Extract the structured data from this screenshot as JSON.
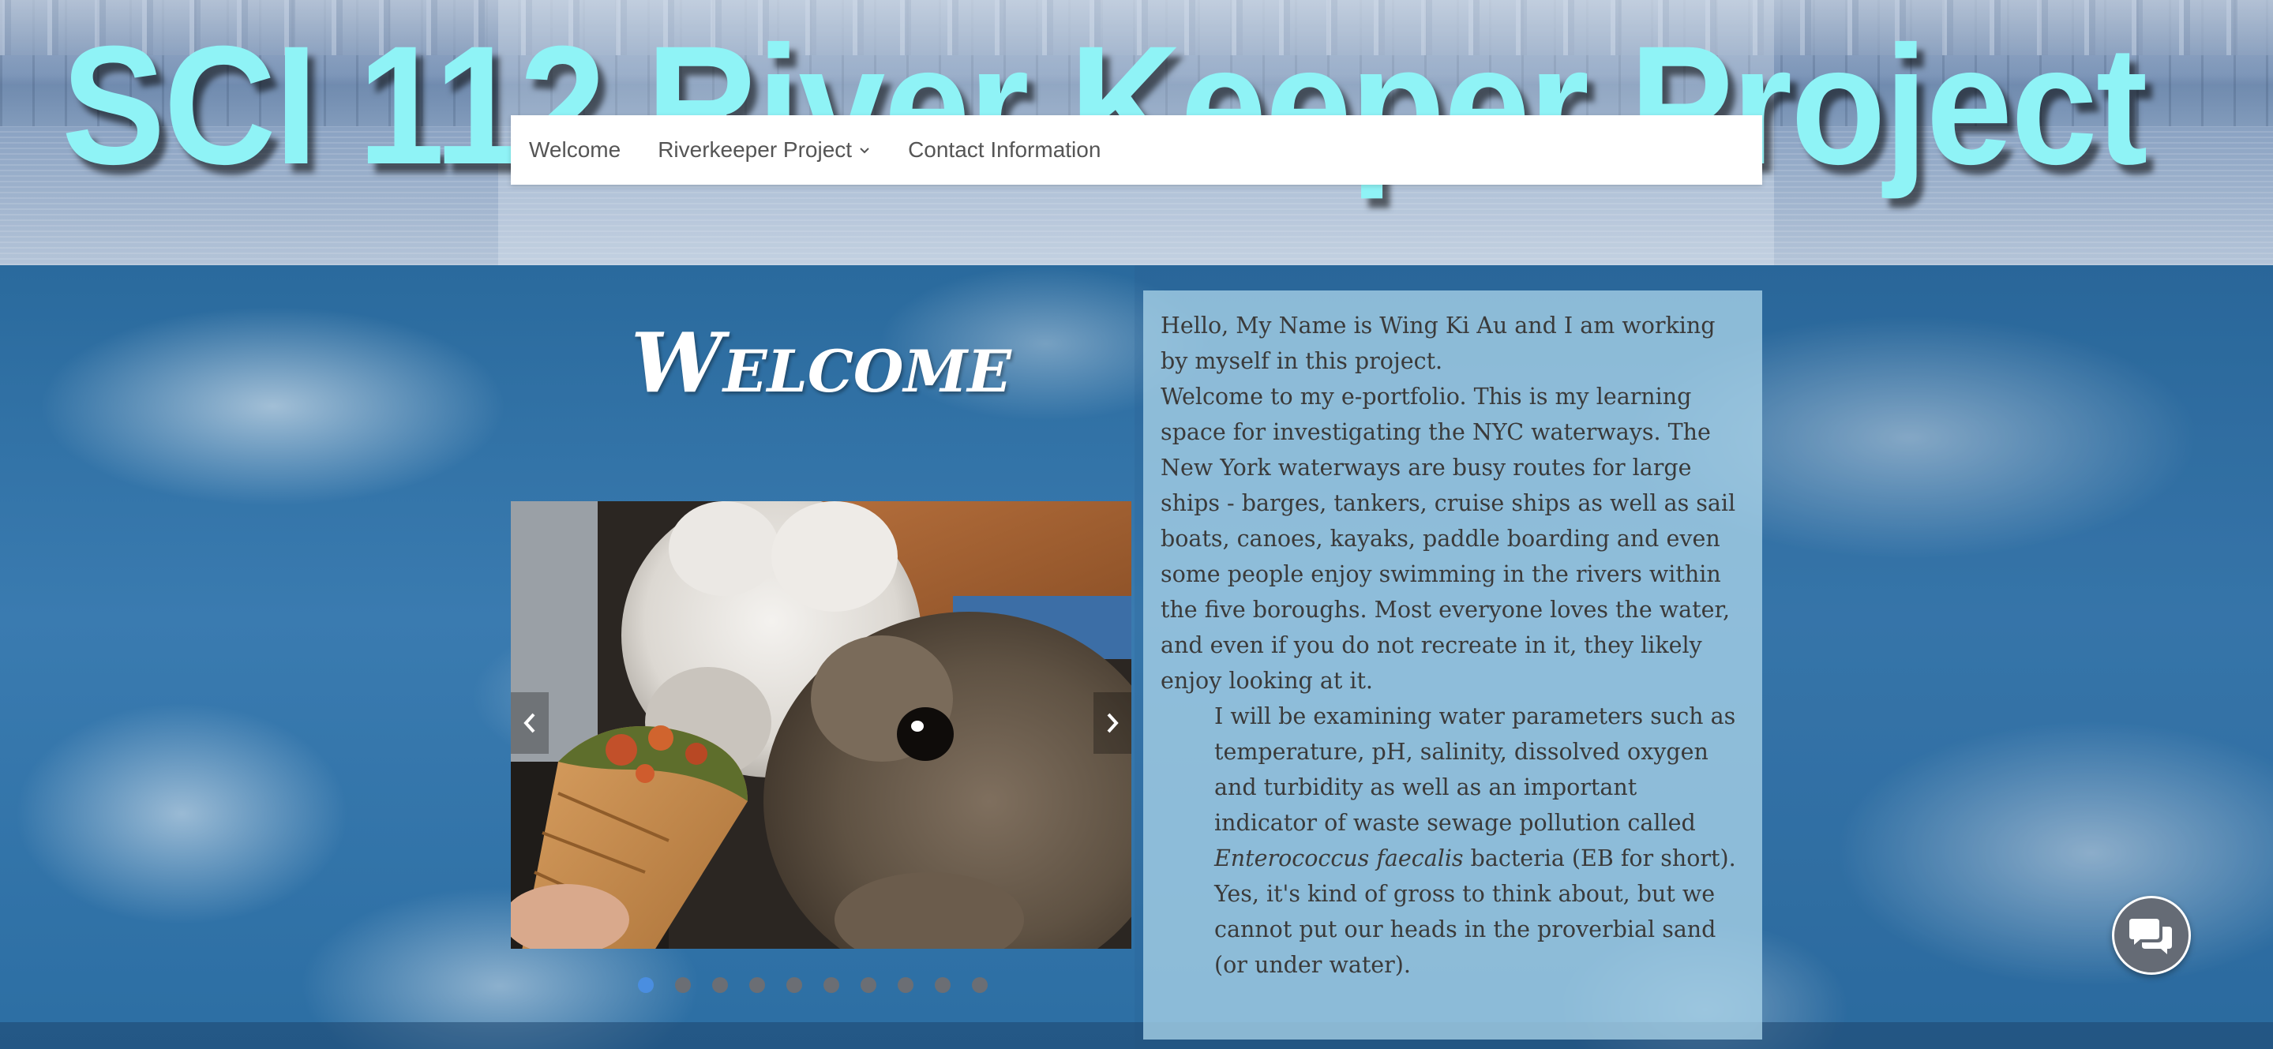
{
  "header": {
    "site_title": "SCI 112 River Keeper Project"
  },
  "nav": {
    "items": [
      {
        "label": "Welcome"
      },
      {
        "label": "Riverkeeper Project",
        "icon": "chevron-down-icon"
      },
      {
        "label": "Contact Information"
      }
    ]
  },
  "main": {
    "welcome_heading": "Welcome",
    "slideshow": {
      "slide_count": 10,
      "active_index": 0,
      "prev_icon": "chevron-left-icon",
      "next_icon": "chevron-right-icon"
    },
    "intro": {
      "p1": " Hello, My Name is Wing Ki Au and I am working by myself in this project.",
      "p2": "Welcome  to my e-portfolio. This is my learning space for investigating the NYC  waterways. The New York waterways are busy routes for large ships -  barges, tankers, cruise ships as well as sail boats, canoes, kayaks, paddle boarding and even some people enjoy swimming in the rivers within  the five boroughs. Most everyone loves the water, and even if you do  not recreate in it, they likely enjoy looking at it.",
      "p3_before": "I will be examining water parameters such  as temperature, pH, salinity, dissolved oxygen and turbidity as well as  an important indicator of waste sewage pollution called ",
      "p3_italic": "Enterococcus faecalis",
      "p3_after": "  bacteria (EB for short). Yes, it's kind of gross to think about, but we cannot put our heads in the proverbial sand (or under water)."
    }
  },
  "chat": {
    "icon": "chat-bubbles-icon"
  },
  "colors": {
    "title_cyan": "#8ff3f6",
    "nav_text": "#555555",
    "dot_active": "#4a8ee0",
    "dot_inactive": "#6b6e74",
    "panel_bg": "#a8d2e8",
    "chat_bg": "#656b75"
  }
}
